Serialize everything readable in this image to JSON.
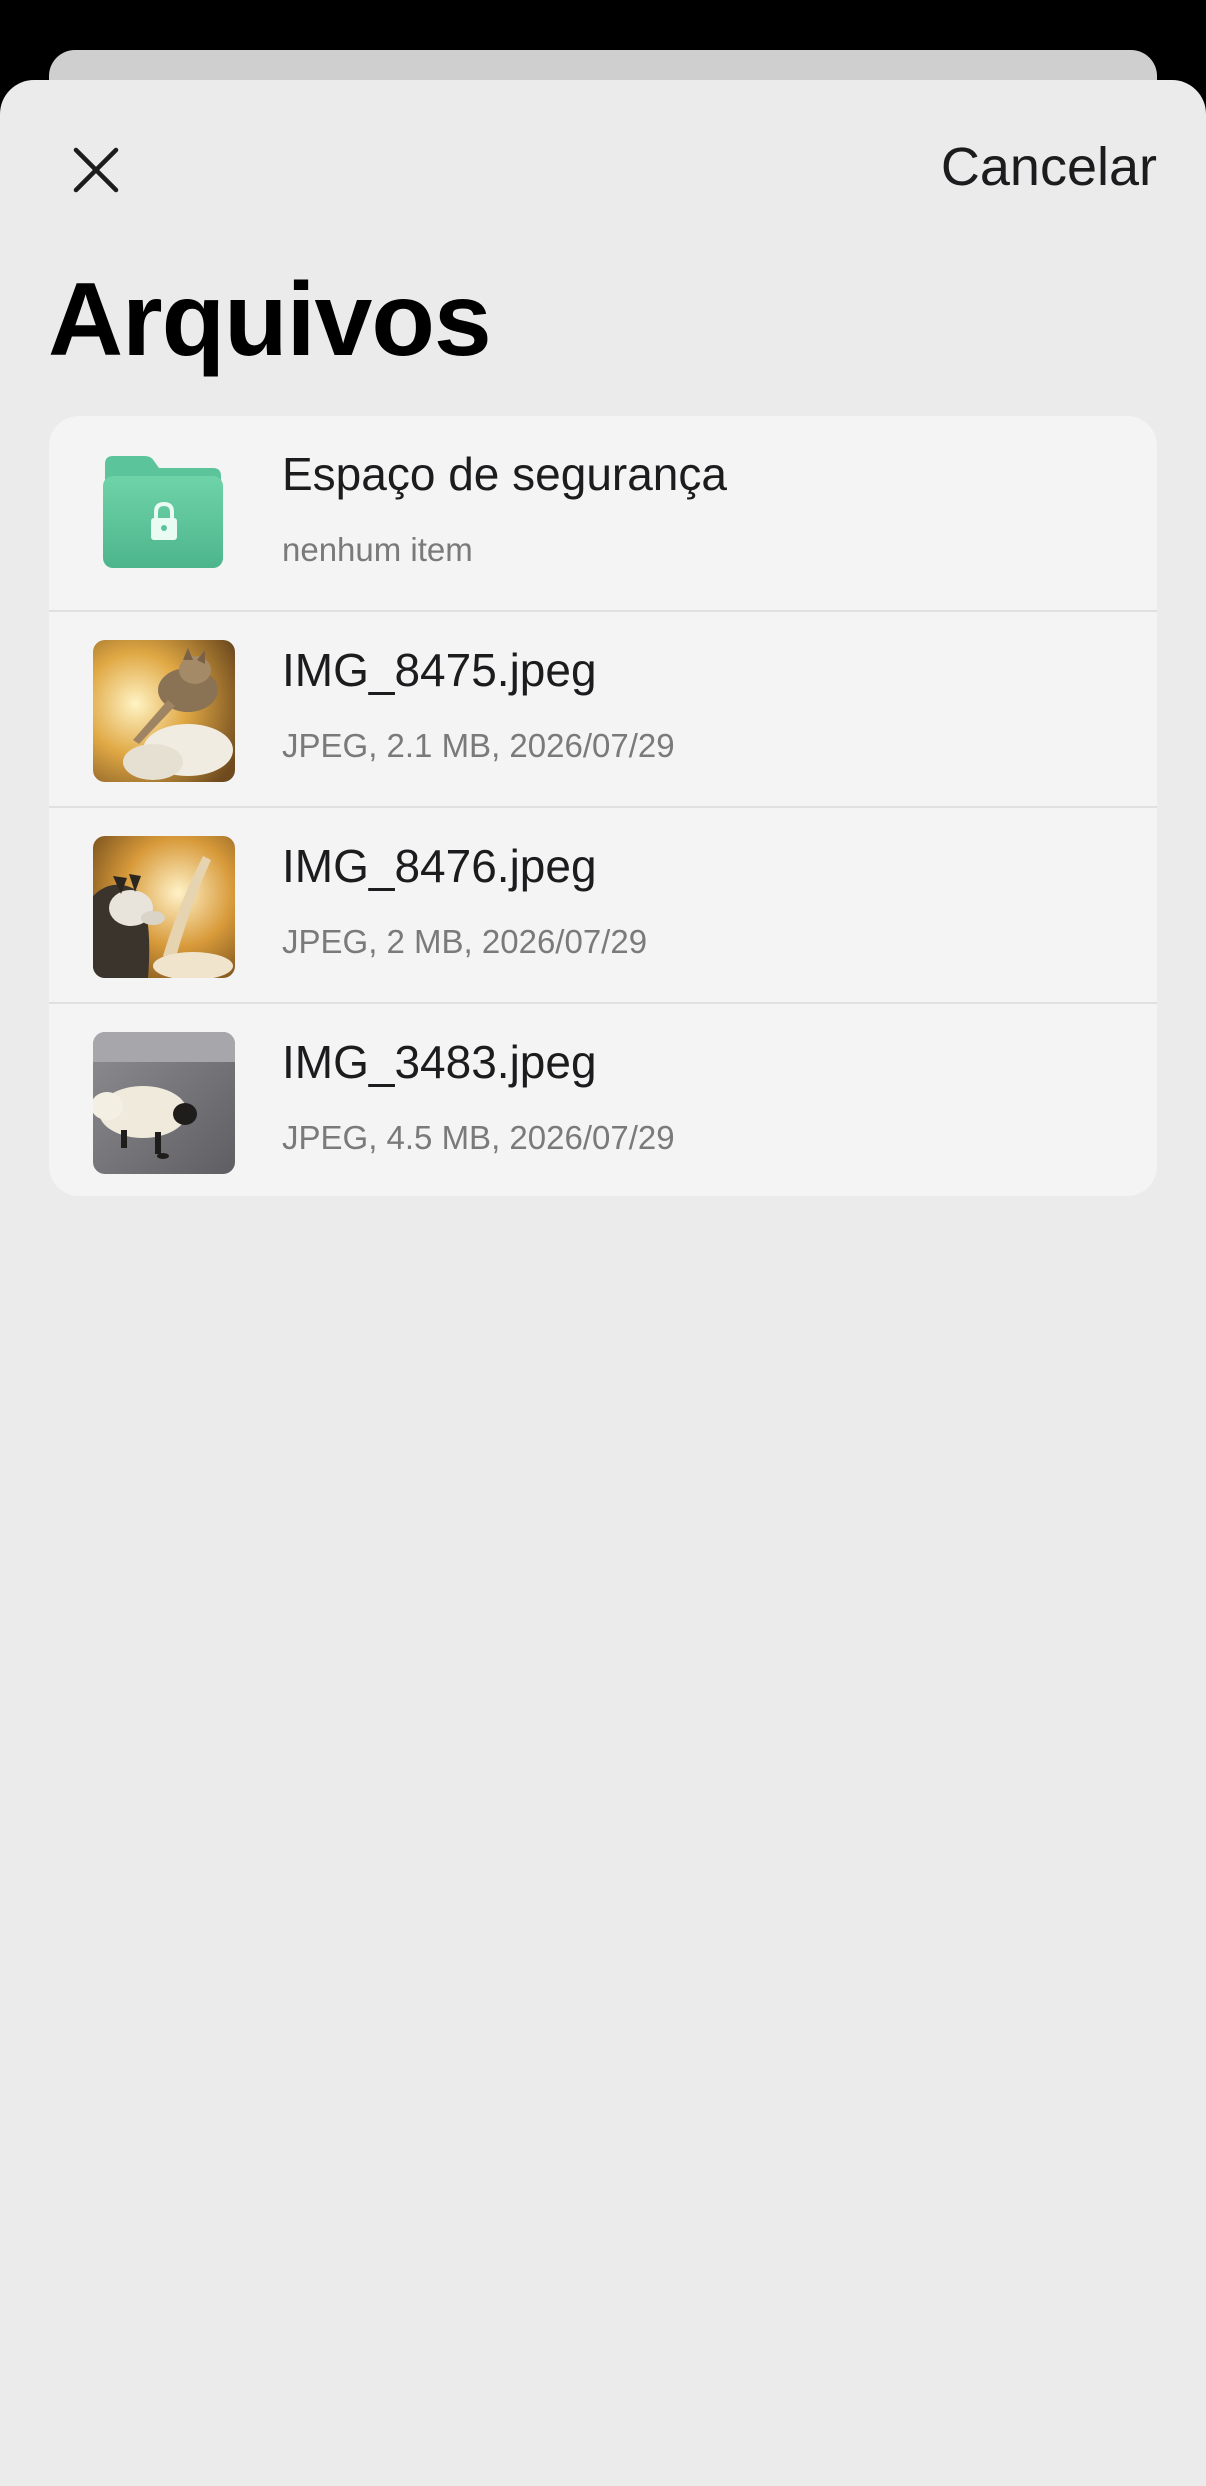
{
  "sheet": {
    "title": "Arquivos",
    "cancel_label": "Cancelar",
    "close_icon": "close-icon"
  },
  "files": [
    {
      "name": "Espaço de segurança",
      "meta": "nenhum item",
      "icon": "secure-folder-icon"
    },
    {
      "name": "IMG_8475.jpeg",
      "meta": "JPEG, 2.1 MB, 2026/07/29",
      "icon": "image-thumbnail"
    },
    {
      "name": "IMG_8476.jpeg",
      "meta": "JPEG, 2 MB, 2026/07/29",
      "icon": "image-thumbnail"
    },
    {
      "name": "IMG_3483.jpeg",
      "meta": "JPEG, 4.5 MB, 2026/07/29",
      "icon": "image-thumbnail"
    }
  ],
  "colors": {
    "folder": "#5cc49a",
    "sheet_bg": "#ebebeb",
    "list_bg": "#f4f4f4"
  }
}
